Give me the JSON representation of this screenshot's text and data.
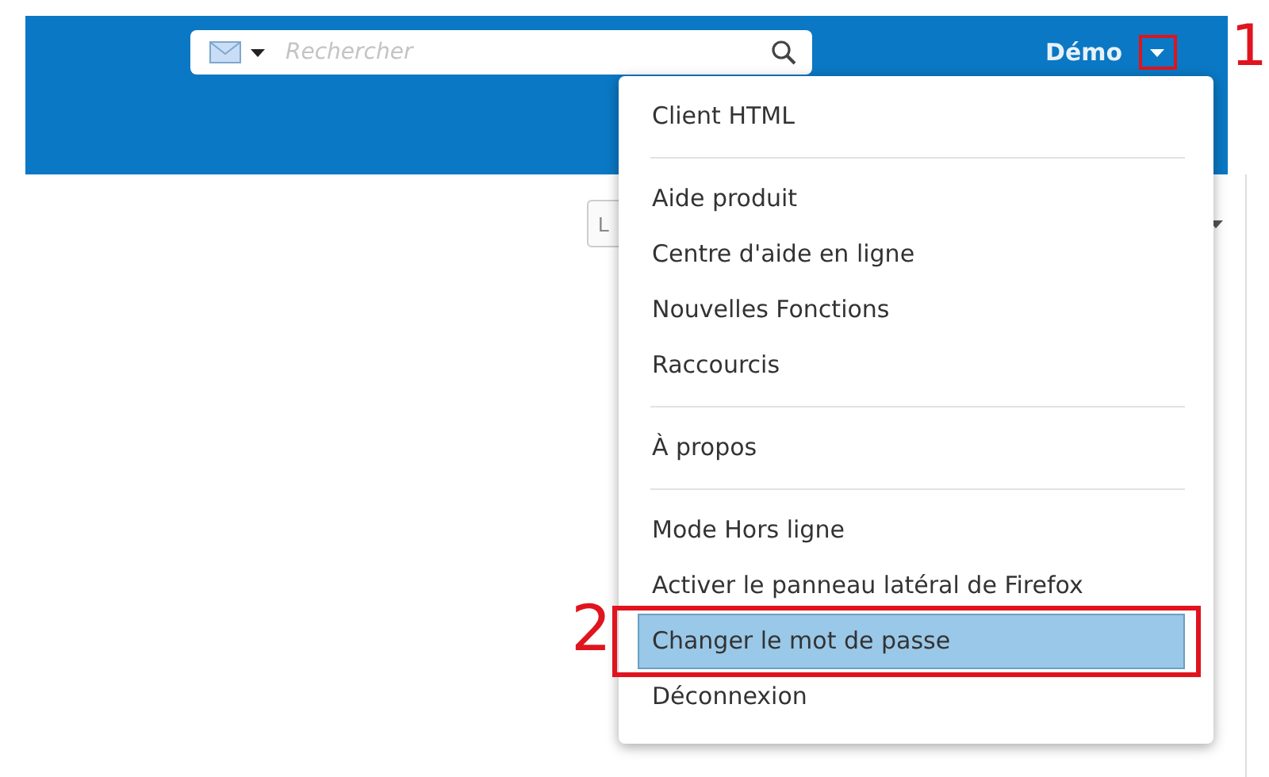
{
  "header": {
    "search": {
      "placeholder": "Rechercher"
    },
    "user": "Démo"
  },
  "toolbar": {
    "button_label": "L"
  },
  "menu": {
    "groups": [
      {
        "items": [
          {
            "label": "Client HTML",
            "selected": false
          }
        ]
      },
      {
        "items": [
          {
            "label": "Aide produit",
            "selected": false
          },
          {
            "label": "Centre d'aide en ligne",
            "selected": false
          },
          {
            "label": "Nouvelles Fonctions",
            "selected": false
          },
          {
            "label": "Raccourcis",
            "selected": false
          }
        ]
      },
      {
        "items": [
          {
            "label": "À propos",
            "selected": false
          }
        ]
      },
      {
        "items": [
          {
            "label": "Mode Hors ligne",
            "selected": false
          },
          {
            "label": "Activer le panneau latéral de Firefox",
            "selected": false
          },
          {
            "label": "Changer le mot de passe",
            "selected": true
          },
          {
            "label": "Déconnexion",
            "selected": false
          }
        ]
      }
    ]
  },
  "annotations": [
    {
      "label": "1"
    },
    {
      "label": "2"
    }
  ]
}
